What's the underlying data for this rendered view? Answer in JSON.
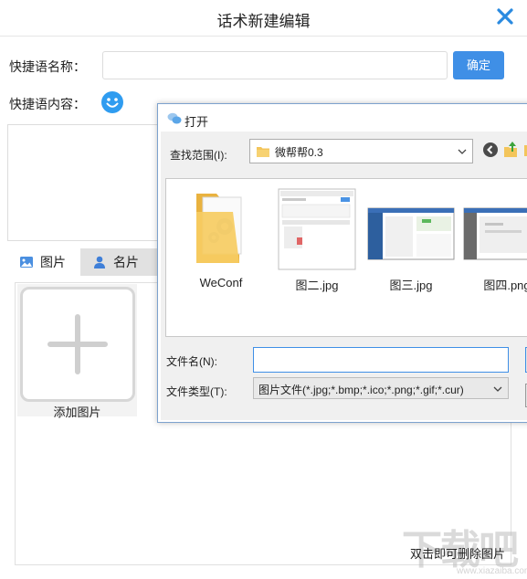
{
  "window": {
    "title": "话术新建编辑",
    "close_icon": "close-icon",
    "accent_color": "#3f8fe6"
  },
  "form": {
    "name_label": "快捷语名称：",
    "name_value": "",
    "confirm_label": "确定",
    "content_label": "快捷语内容：",
    "emoji_icon": "smiley-icon"
  },
  "tabs": [
    {
      "label": "图片",
      "icon": "image-icon",
      "active": true
    },
    {
      "label": "名片",
      "icon": "person-icon",
      "active": false
    }
  ],
  "images_panel": {
    "add_label": "添加图片",
    "hint": "双击即可删除图片"
  },
  "watermark": {
    "text": "下载吧",
    "url": "www.xiazaiba.com"
  },
  "dialog": {
    "title": "打开",
    "look_in_label": "查找范围(I):",
    "look_in_value": "微帮帮0.3",
    "files": [
      {
        "name": "WeConf",
        "type": "folder"
      },
      {
        "name": "图二.jpg",
        "type": "image"
      },
      {
        "name": "图三.jpg",
        "type": "image"
      },
      {
        "name": "图四.png",
        "type": "image"
      }
    ],
    "file_name_label": "文件名(N):",
    "file_name_value": "",
    "file_type_label": "文件类型(T):",
    "file_type_value": "图片文件(*.jpg;*.bmp;*.ico;*.png;*.gif;*.cur)"
  }
}
